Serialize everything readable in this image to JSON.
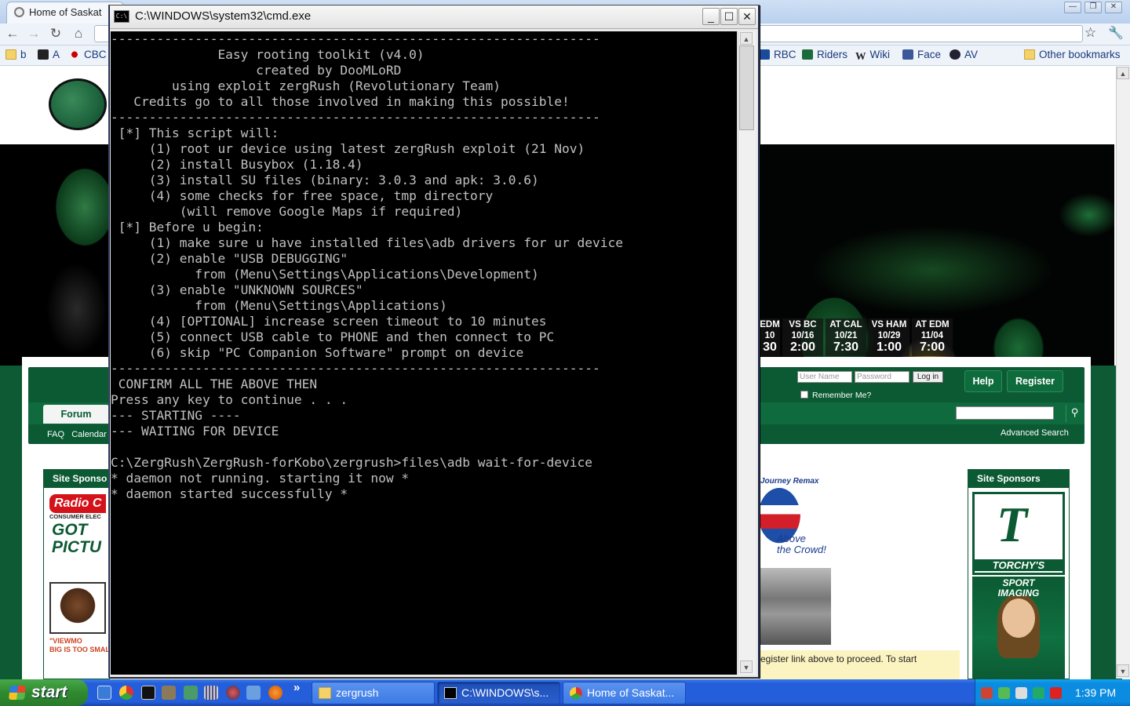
{
  "browser": {
    "tab_title": "Home of Saskat",
    "bookmarks": [
      {
        "label": "b",
        "icon": "folder-icon"
      },
      {
        "label": "A",
        "icon": "amazon-icon"
      },
      {
        "label": "CBC",
        "icon": "cbc-icon"
      },
      {
        "label": "RBC",
        "icon": "rbc-icon"
      },
      {
        "label": "Riders",
        "icon": "riders-icon"
      },
      {
        "label": "Wiki",
        "icon": "wikipedia-icon"
      },
      {
        "label": "Face",
        "icon": "facebook-icon"
      },
      {
        "label": "AV",
        "icon": "av-icon"
      }
    ],
    "other_bookmarks": "Other bookmarks"
  },
  "site": {
    "schedule": [
      {
        "team": "EDM",
        "date": "10",
        "time": "30"
      },
      {
        "team": "VS BC",
        "date": "10/16",
        "time": "2:00"
      },
      {
        "team": "AT CAL",
        "date": "10/21",
        "time": "7:30"
      },
      {
        "team": "VS HAM",
        "date": "10/29",
        "time": "1:00"
      },
      {
        "team": "AT EDM",
        "date": "11/04",
        "time": "7:00"
      }
    ],
    "login": {
      "username_placeholder": "User Name",
      "password_placeholder": "Password",
      "login_button": "Log in",
      "remember_me": "Remember Me?"
    },
    "help_label": "Help",
    "register_label": "Register",
    "forum_tab": "Forum",
    "sublinks": [
      "FAQ",
      "Calendar"
    ],
    "advanced_search": "Advanced Search",
    "sponsors_left_heading": "Site Sponso",
    "sponsors_right_heading": "Site Sponsors",
    "radio_logo": "Radio C",
    "consumer_text": "CONSUMER ELEC",
    "got_text": "GOT\nPICTU",
    "viewmo_text": "\"VIEWMO\nBIG IS TOO SMALL & IT",
    "remax_title": "Journey Remax",
    "remax_tagline": "Above\nthe Crowd!",
    "notice_text": "egister link above to proceed. To start",
    "torchys_name": "TORCHY'S",
    "sport_imaging": "SPORT\nIMAGING"
  },
  "cmd": {
    "title": "C:\\WINDOWS\\system32\\cmd.exe",
    "lines": [
      "----------------------------------------------------------------",
      "              Easy rooting toolkit (v4.0)",
      "                   created by DooMLoRD",
      "        using exploit zergRush (Revolutionary Team)",
      "   Credits go to all those involved in making this possible!",
      "----------------------------------------------------------------",
      " [*] This script will:",
      "     (1) root ur device using latest zergRush exploit (21 Nov)",
      "     (2) install Busybox (1.18.4)",
      "     (3) install SU files (binary: 3.0.3 and apk: 3.0.6)",
      "     (4) some checks for free space, tmp directory",
      "         (will remove Google Maps if required)",
      " [*] Before u begin:",
      "     (1) make sure u have installed files\\adb drivers for ur device",
      "     (2) enable \"USB DEBUGGING\"",
      "           from (Menu\\Settings\\Applications\\Development)",
      "     (3) enable \"UNKNOWN SOURCES\"",
      "           from (Menu\\Settings\\Applications)",
      "     (4) [OPTIONAL] increase screen timeout to 10 minutes",
      "     (5) connect USB cable to PHONE and then connect to PC",
      "     (6) skip \"PC Companion Software\" prompt on device",
      "----------------------------------------------------------------",
      " CONFIRM ALL THE ABOVE THEN",
      "Press any key to continue . . .",
      "--- STARTING ----",
      "--- WAITING FOR DEVICE",
      "",
      "C:\\ZergRush\\ZergRush-forKobo\\zergrush>files\\adb wait-for-device",
      "* daemon not running. starting it now *",
      "* daemon started successfully *"
    ]
  },
  "taskbar": {
    "start_label": "start",
    "tasks": [
      {
        "label": "zergrush",
        "icon": "folder-icon"
      },
      {
        "label": "C:\\WINDOWS\\s...",
        "icon": "cmd-icon"
      },
      {
        "label": "Home of Saskat...",
        "icon": "chrome-icon"
      }
    ],
    "clock": "1:39 PM",
    "overflow": "»"
  }
}
